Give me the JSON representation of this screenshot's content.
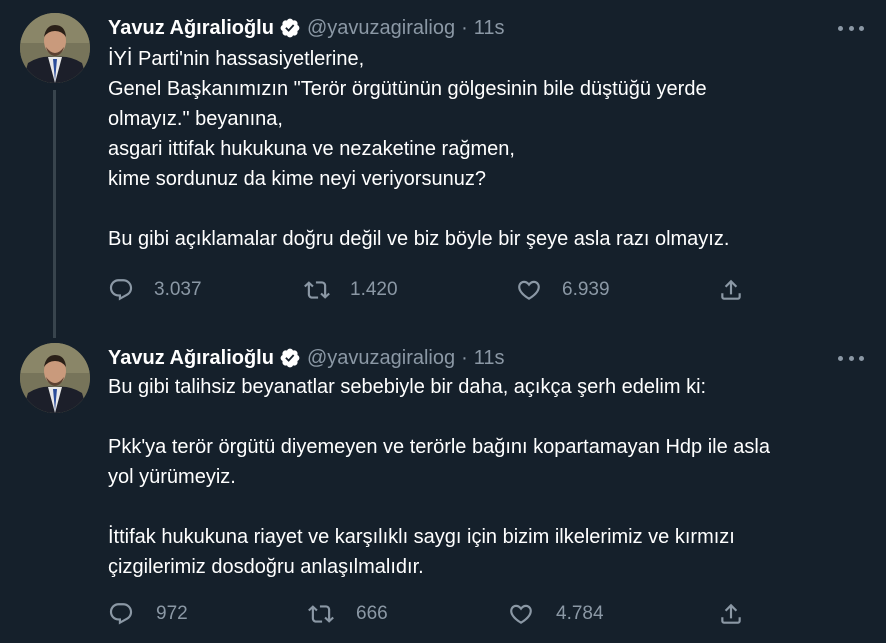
{
  "tweets": [
    {
      "author": {
        "display_name": "Yavuz Ağıralioğlu",
        "handle": "@yavuzagiraliog",
        "verified": true
      },
      "separator": "·",
      "time": "11s",
      "lines": [
        "İYİ Parti'nin hassasiyetlerine,",
        "Genel Başkanımızın \"Terör örgütünün gölgesinin bile düştüğü yerde",
        "olmayız.\" beyanına,",
        "asgari ittifak hukukuna ve nezaketine rağmen,",
        "kime sordunuz da kime neyi veriyorsunuz?",
        "",
        "Bu gibi açıklamalar doğru değil ve biz böyle bir şeye asla razı olmayız."
      ],
      "counts": {
        "replies": "3.037",
        "retweets": "1.420",
        "likes": "6.939"
      }
    },
    {
      "author": {
        "display_name": "Yavuz Ağıralioğlu",
        "handle": "@yavuzagiraliog",
        "verified": true
      },
      "separator": "·",
      "time": "11s",
      "lines": [
        "Bu gibi talihsiz beyanatlar sebebiyle bir daha, açıkça şerh edelim ki:",
        "",
        "Pkk'ya terör örgütü diyemeyen ve terörle bağını kopartamayan Hdp ile asla",
        "yol yürümeyiz.",
        "",
        "İttifak hukukuna riayet ve karşılıklı saygı için bizim ilkelerimiz ve kırmızı",
        "çizgilerimiz dosdoğru anlaşılmalıdır."
      ],
      "counts": {
        "replies": "972",
        "retweets": "666",
        "likes": "4.784"
      }
    }
  ],
  "icons": {
    "more": "more-horizontal-icon",
    "verified": "verified-badge-icon",
    "reply": "reply-icon",
    "retweet": "retweet-icon",
    "like": "heart-icon",
    "share": "share-icon"
  },
  "colors": {
    "background": "#15202b",
    "text": "#ffffff",
    "muted": "#8b98a5",
    "thread_line": "#38444d"
  }
}
